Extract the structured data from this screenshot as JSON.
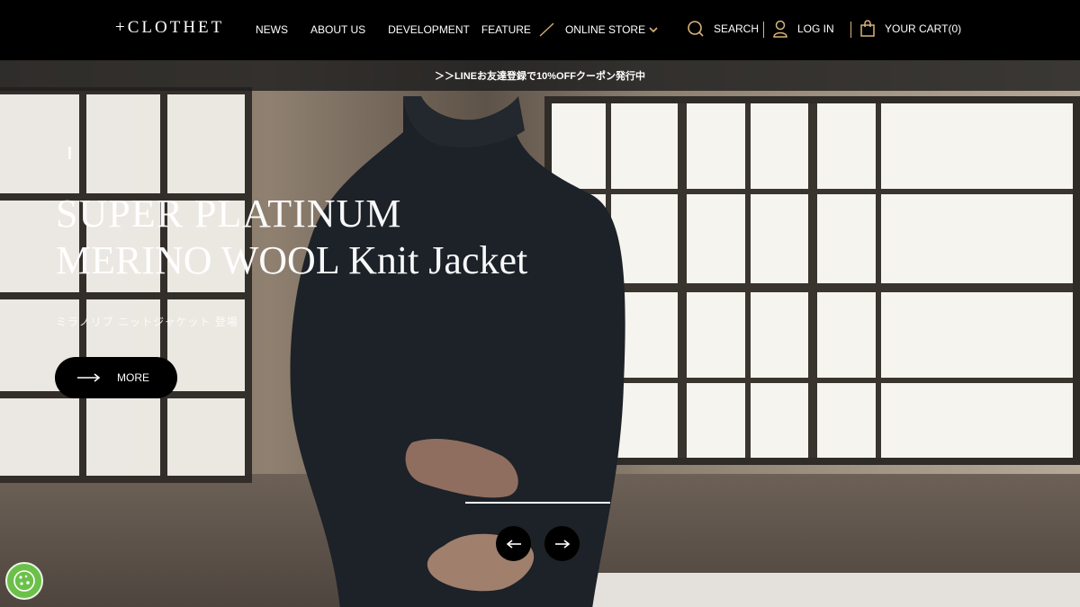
{
  "header": {
    "logo": "+CLOTHET",
    "nav": [
      "NEWS",
      "ABOUT US",
      "DEVELOPMENT",
      "FEATURE",
      "ONLINE STORE"
    ],
    "search_label": "SEARCH",
    "login_label": "LOG IN",
    "cart_label": "YOUR CART(0)"
  },
  "announcement": "＞＞LINEお友達登録で10%OFFクーポン発行中",
  "hero": {
    "headline_line1": "SUPER PLATINUM",
    "headline_line2": "MERINO WOOL Knit Jacket",
    "subtitle": "ミラノリブ ニットジャケット 登場",
    "more_label": "MORE"
  },
  "colors": {
    "accent": "#d9b47a",
    "header_bg": "#000000",
    "cookie_green": "#6cc04a"
  },
  "icons": [
    "search-icon",
    "user-icon",
    "bag-icon",
    "chevron-down-icon",
    "arrow-right-icon",
    "arrow-left-icon",
    "cookie-icon"
  ]
}
